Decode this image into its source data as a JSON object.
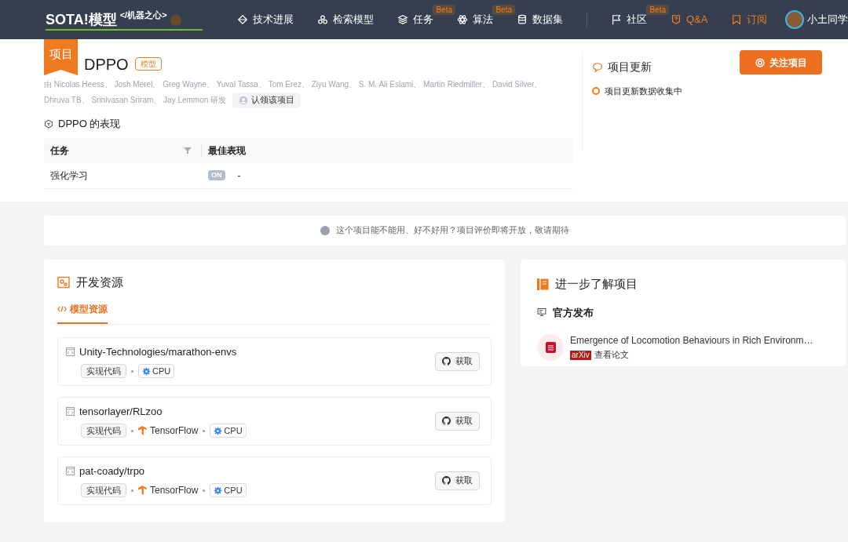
{
  "header": {
    "logo": "SOTA!模型",
    "logo_tag": "</机器之心>",
    "nav_primary": [
      {
        "label": "技术进展"
      },
      {
        "label": "检索模型"
      },
      {
        "label": "任务",
        "badge": "Beta"
      },
      {
        "label": "算法",
        "badge": "Beta"
      },
      {
        "label": "数据集"
      }
    ],
    "nav_secondary": [
      {
        "label": "社区",
        "badge": "Beta",
        "highlighted": false
      },
      {
        "label": "Q&A",
        "highlighted": true
      },
      {
        "label": "订阅",
        "highlighted": true
      }
    ],
    "user": "小土同学"
  },
  "project": {
    "ribbon": "项目",
    "title": "DPPO",
    "type_tag": "模型",
    "authors": [
      "由 Nicolas Heess、 Josh Merel、 Greg Wayne、 Yuval Tassa、 Tom Erez、 Ziyu Wang、 S. M. Ali Eslami、 Martin Riedmiller、 David Silver、",
      "Dhruva TB、 Srinivasan Sriram、 Jay Lemmon 研发"
    ],
    "claim_button": "认领该项目"
  },
  "performance": {
    "title": "DPPO 的表现",
    "columns": [
      "任务",
      "最佳表现"
    ],
    "rows": [
      {
        "task": "强化学习",
        "badge": "ON",
        "value": "-"
      }
    ]
  },
  "updates": {
    "title": "项目更新",
    "follow_button": "关注项目",
    "items": [
      "项目更新数据收集中"
    ]
  },
  "notice": "这个项目能不能用、好不好用？项目评价即将开放，敬请期待",
  "dev_resources": {
    "title": "开发资源",
    "tabs": [
      {
        "label": "模型资源",
        "selected": true
      }
    ],
    "items": [
      {
        "name": "Unity-Technologies/marathon-envs",
        "tags": [
          {
            "kind": "tag",
            "label": "实现代码"
          },
          {
            "kind": "hardware",
            "label": "CPU"
          }
        ],
        "button": "获取"
      },
      {
        "name": "tensorlayer/RLzoo",
        "tags": [
          {
            "kind": "tag",
            "label": "实现代码"
          },
          {
            "kind": "framework",
            "label": "TensorFlow"
          },
          {
            "kind": "hardware",
            "label": "CPU"
          }
        ],
        "button": "获取"
      },
      {
        "name": "pat-coady/trpo",
        "tags": [
          {
            "kind": "tag",
            "label": "实现代码"
          },
          {
            "kind": "framework",
            "label": "TensorFlow"
          },
          {
            "kind": "hardware",
            "label": "CPU"
          }
        ],
        "button": "获取"
      }
    ]
  },
  "learn_more": {
    "title": "进一步了解项目",
    "section": "官方发布",
    "papers": [
      {
        "title": "Emergence of Locomotion Behaviours in Rich Environm…",
        "source": "arXiv",
        "link": "查看论文"
      }
    ]
  }
}
